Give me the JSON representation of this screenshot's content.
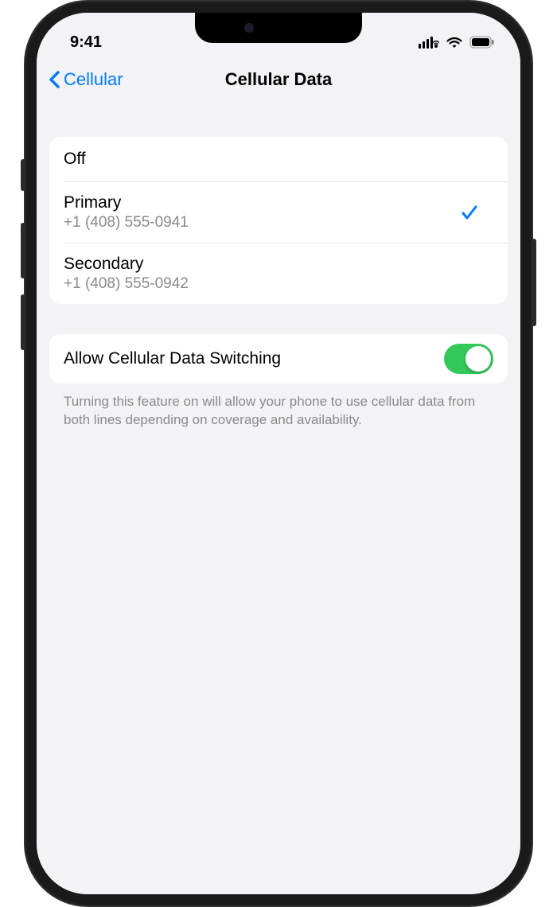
{
  "status_bar": {
    "time": "9:41"
  },
  "nav": {
    "back_label": "Cellular",
    "title": "Cellular Data"
  },
  "data_options": [
    {
      "label": "Off",
      "subtitle": "",
      "selected": false
    },
    {
      "label": "Primary",
      "subtitle": "+1 (408) 555-0941",
      "selected": true
    },
    {
      "label": "Secondary",
      "subtitle": "+1 (408) 555-0942",
      "selected": false
    }
  ],
  "switching": {
    "label": "Allow Cellular Data Switching",
    "enabled": true,
    "footer": "Turning this feature on will allow your phone to use cellular data from both lines depending on coverage and availability."
  }
}
